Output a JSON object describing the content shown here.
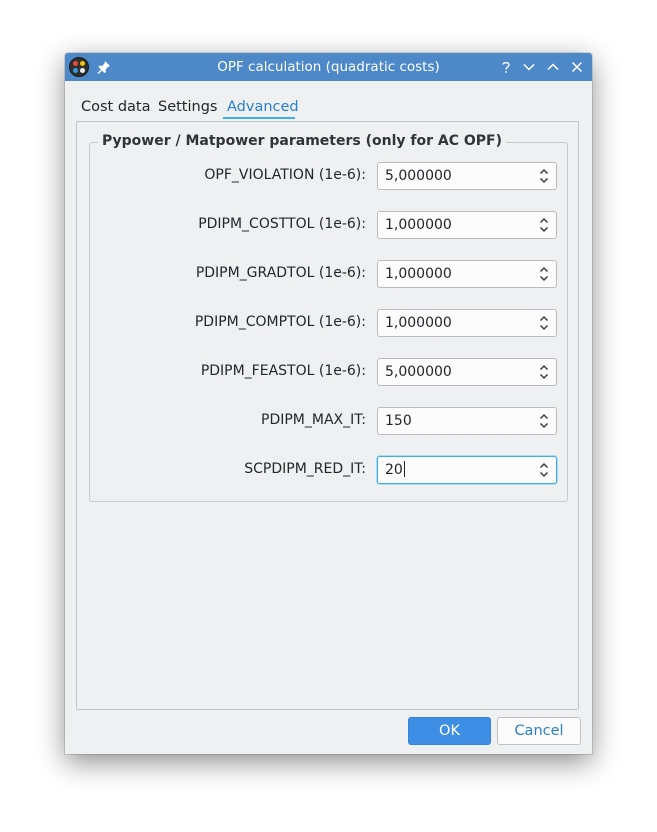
{
  "window": {
    "title": "OPF calculation (quadratic costs)",
    "titlebar_buttons": [
      "help-icon",
      "minimize-icon",
      "maximize-icon",
      "close-icon"
    ],
    "accent_color": "#4d89c9"
  },
  "tabs": [
    {
      "label": "Cost data",
      "active": false
    },
    {
      "label": "Settings",
      "active": false
    },
    {
      "label": "Advanced",
      "active": true
    }
  ],
  "group": {
    "title": "Pypower / Matpower parameters (only for AC OPF)"
  },
  "params": [
    {
      "label": "OPF_VIOLATION (1e-6):",
      "value": "5,000000"
    },
    {
      "label": "PDIPM_COSTTOL (1e-6):",
      "value": "1,000000"
    },
    {
      "label": "PDIPM_GRADTOL (1e-6):",
      "value": "1,000000"
    },
    {
      "label": "PDIPM_COMPTOL (1e-6):",
      "value": "1,000000"
    },
    {
      "label": "PDIPM_FEASTOL (1e-6):",
      "value": "5,000000"
    },
    {
      "label": "PDIPM_MAX_IT:",
      "value": "150"
    },
    {
      "label": "SCPDIPM_RED_IT:",
      "value": "20"
    }
  ],
  "buttons": {
    "ok": "OK",
    "cancel": "Cancel"
  }
}
